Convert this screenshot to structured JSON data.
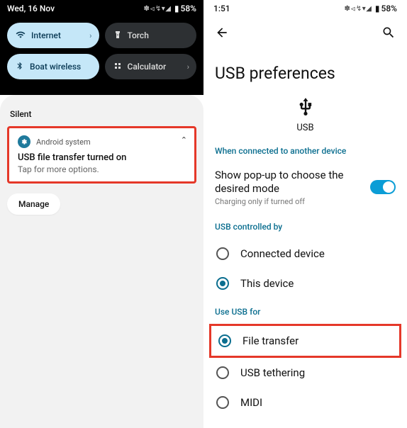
{
  "left": {
    "status": {
      "date": "Wed, 16 Nov",
      "battery": "58%"
    },
    "qs": {
      "internet": "Internet",
      "torch": "Torch",
      "boat": "Boat wireless",
      "calc": "Calculator"
    },
    "silent_header": "Silent",
    "notif": {
      "app": "Android system",
      "title": "USB file transfer turned on",
      "sub": "Tap for more options."
    },
    "manage": "Manage"
  },
  "right": {
    "status": {
      "time": "1:51",
      "battery": "58%"
    },
    "title": "USB preferences",
    "usb_label": "USB",
    "section_connected": "When connected to another device",
    "popup": {
      "title": "Show pop-up to choose the desired mode",
      "sub": "Charging only if turned off"
    },
    "section_controlled": "USB controlled by",
    "radio_connected": "Connected device",
    "radio_this": "This device",
    "section_usefor": "Use USB for",
    "radio_file": "File transfer",
    "radio_tether": "USB tethering",
    "radio_midi": "MIDI"
  }
}
